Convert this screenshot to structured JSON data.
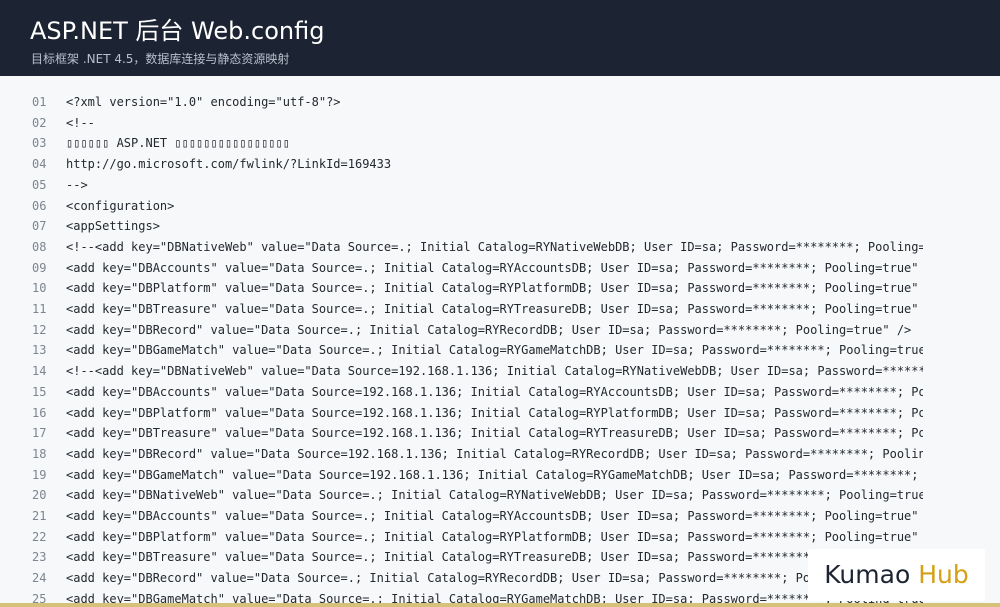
{
  "header": {
    "title": "ASP.NET 后台 Web.config",
    "subtitle": "目标框架 .NET 4.5，数据库连接与静态资源映射"
  },
  "code_lines": [
    {
      "num": "01",
      "text": "<?xml version=\"1.0\" encoding=\"utf-8\"?>"
    },
    {
      "num": "02",
      "text": "<!--"
    },
    {
      "num": "03",
      "text": "▯▯▯▯▯▯ ASP.NET ▯▯▯▯▯▯▯▯▯▯▯▯▯▯▯▯"
    },
    {
      "num": "04",
      "text": "http://go.microsoft.com/fwlink/?LinkId=169433"
    },
    {
      "num": "05",
      "text": "-->"
    },
    {
      "num": "06",
      "text": "<configuration>"
    },
    {
      "num": "07",
      "text": "<appSettings>"
    },
    {
      "num": "08",
      "text": "<!--<add key=\"DBNativeWeb\" value=\"Data Source=.; Initial Catalog=RYNativeWebDB; User ID=sa; Password=********; Pooling=t"
    },
    {
      "num": "09",
      "text": "<add key=\"DBAccounts\" value=\"Data Source=.; Initial Catalog=RYAccountsDB; User ID=sa; Password=********; Pooling=true\" /"
    },
    {
      "num": "10",
      "text": "<add key=\"DBPlatform\" value=\"Data Source=.; Initial Catalog=RYPlatformDB; User ID=sa; Password=********; Pooling=true\" /"
    },
    {
      "num": "11",
      "text": "<add key=\"DBTreasure\" value=\"Data Source=.; Initial Catalog=RYTreasureDB; User ID=sa; Password=********; Pooling=true\" /"
    },
    {
      "num": "12",
      "text": "<add key=\"DBRecord\" value=\"Data Source=.; Initial Catalog=RYRecordDB; User ID=sa; Password=********; Pooling=true\" />"
    },
    {
      "num": "13",
      "text": "<add key=\"DBGameMatch\" value=\"Data Source=.; Initial Catalog=RYGameMatchDB; User ID=sa; Password=********; Pooling=true\""
    },
    {
      "num": "14",
      "text": "<!--<add key=\"DBNativeWeb\" value=\"Data Source=192.168.1.136; Initial Catalog=RYNativeWebDB; User ID=sa; Password=*******"
    },
    {
      "num": "15",
      "text": "<add key=\"DBAccounts\" value=\"Data Source=192.168.1.136; Initial Catalog=RYAccountsDB; User ID=sa; Password=********; Poo"
    },
    {
      "num": "16",
      "text": "<add key=\"DBPlatform\" value=\"Data Source=192.168.1.136; Initial Catalog=RYPlatformDB; User ID=sa; Password=********; Poo"
    },
    {
      "num": "17",
      "text": "<add key=\"DBTreasure\" value=\"Data Source=192.168.1.136; Initial Catalog=RYTreasureDB; User ID=sa; Password=********; Poo"
    },
    {
      "num": "18",
      "text": "<add key=\"DBRecord\" value=\"Data Source=192.168.1.136; Initial Catalog=RYRecordDB; User ID=sa; Password=********; Pooling"
    },
    {
      "num": "19",
      "text": "<add key=\"DBGameMatch\" value=\"Data Source=192.168.1.136; Initial Catalog=RYGameMatchDB; User ID=sa; Password=********; P"
    },
    {
      "num": "20",
      "text": "<add key=\"DBNativeWeb\" value=\"Data Source=.; Initial Catalog=RYNativeWebDB; User ID=sa; Password=********; Pooling=true\""
    },
    {
      "num": "21",
      "text": "<add key=\"DBAccounts\" value=\"Data Source=.; Initial Catalog=RYAccountsDB; User ID=sa; Password=********; Pooling=true\" /"
    },
    {
      "num": "22",
      "text": "<add key=\"DBPlatform\" value=\"Data Source=.; Initial Catalog=RYPlatformDB; User ID=sa; Password=********; Pooling=true\" /"
    },
    {
      "num": "23",
      "text": "<add key=\"DBTreasure\" value=\"Data Source=.; Initial Catalog=RYTreasureDB; User ID=sa; Password=********;"
    },
    {
      "num": "24",
      "text": "<add key=\"DBRecord\" value=\"Data Source=.; Initial Catalog=RYRecordDB; User ID=sa; Password=********; Poo"
    },
    {
      "num": "25",
      "text": "<add key=\"DBGameMatch\" value=\"Data Source=.; Initial Catalog=RYGameMatchDB; User ID=sa; Password=********; Pooling=true\""
    }
  ],
  "watermark": {
    "part1": "Kumao",
    "part2": "Hub"
  },
  "colors": {
    "header_bg": "#1c2333",
    "code_bg": "#f6f8fa",
    "line_number": "#7d8590",
    "code_text": "#24292f",
    "brand_accent": "#d4a017"
  }
}
